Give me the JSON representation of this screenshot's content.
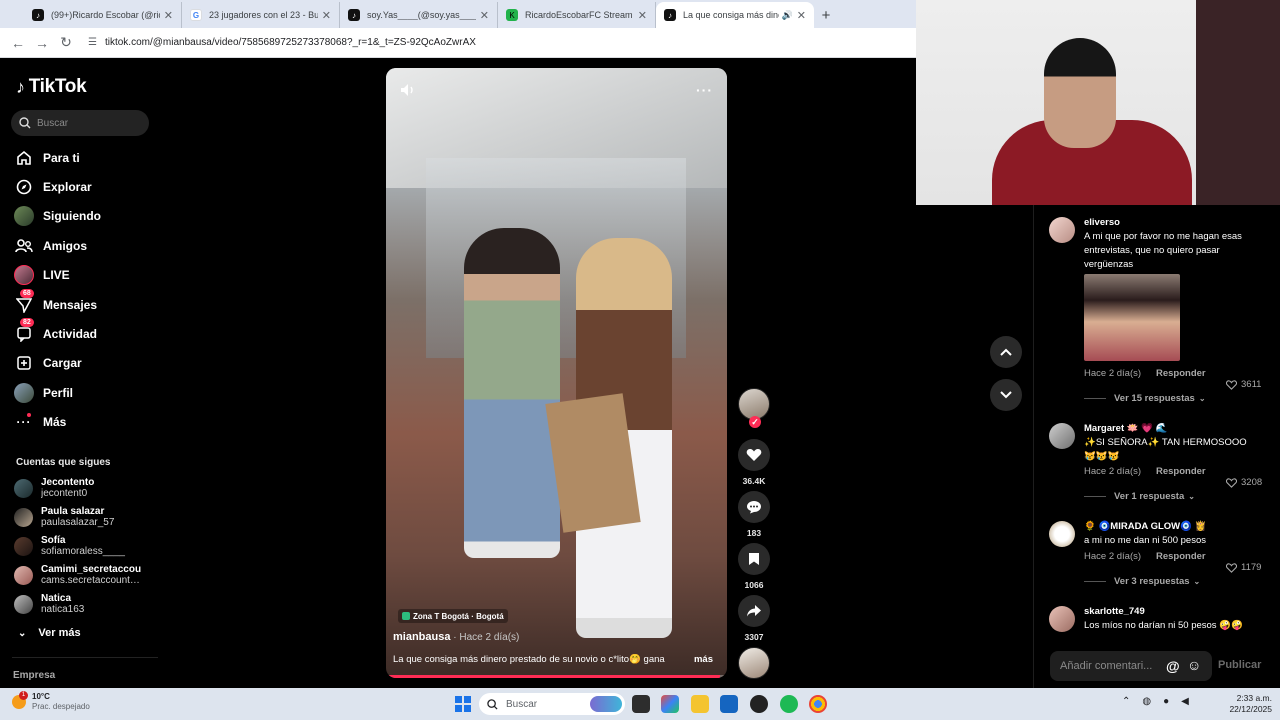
{
  "browser": {
    "tabs": [
      {
        "title": "(99+)Ricardo Escobar (@ric…",
        "icon": "tiktok-icon"
      },
      {
        "title": "23 jugadores con el 23 - Buscar",
        "icon": "google-icon"
      },
      {
        "title": "soy.Yas____(@soy.yas____) |",
        "icon": "tiktok-icon"
      },
      {
        "title": "RicardoEscobarFC Stream - Wa",
        "icon": "kick-icon"
      },
      {
        "title": "La que consiga más dinero",
        "icon": "tiktok-icon",
        "active": true
      }
    ],
    "url": "tiktok.com/@mianbausa/video/7585689725273378068?_r=1&_t=ZS-92QcAoZwrAX"
  },
  "sidebar": {
    "logo": "TikTok",
    "search_placeholder": "Buscar",
    "nav": [
      {
        "label": "Para ti",
        "icon": "home-icon"
      },
      {
        "label": "Explorar",
        "icon": "compass-icon"
      },
      {
        "label": "Siguiendo",
        "icon": "following-avatar-icon"
      },
      {
        "label": "Amigos",
        "icon": "friends-icon"
      },
      {
        "label": "LIVE",
        "icon": "live-avatar-icon"
      },
      {
        "label": "Mensajes",
        "icon": "messages-icon",
        "badge": "68"
      },
      {
        "label": "Actividad",
        "icon": "activity-icon",
        "badge": "82"
      },
      {
        "label": "Cargar",
        "icon": "upload-icon"
      },
      {
        "label": "Perfil",
        "icon": "profile-avatar-icon"
      },
      {
        "label": "Más",
        "icon": "more-dots-icon"
      }
    ],
    "following_header": "Cuentas que sigues",
    "following": [
      {
        "name": "Jecontento",
        "handle": "jecontent0"
      },
      {
        "name": "Paula salazar",
        "handle": "paulasalazar_57"
      },
      {
        "name": "Sofía",
        "handle": "sofiamoraless____"
      },
      {
        "name": "Camimi_secretaccou…",
        "handle": "cams.secretaccount…"
      },
      {
        "name": "Natica",
        "handle": "natica163"
      }
    ],
    "see_more": "Ver más",
    "company": "Empresa"
  },
  "video": {
    "location": "Zona T Bogotá · Bogotá",
    "author": "mianbausa",
    "time": " · Hace 2 día(s)",
    "caption": "La que consiga más dinero prestado de su novio o c*lito🤭 gana",
    "more": "más",
    "progress": 0.98
  },
  "actions": {
    "likes": "36.4K",
    "comments": "183",
    "saves": "1066",
    "shares": "3307"
  },
  "comments": [
    {
      "user": "eliverso",
      "text": "A mi que por favor no me hagan esas entrevistas, que no quiero pasar vergüenzas",
      "time": "Hace 2 día(s)",
      "reply": "Responder",
      "likes": "3611",
      "replies": "Ver 15 respuestas"
    },
    {
      "user": "Margaret 🪷 💗 🌊",
      "text": "✨SI SEÑORA✨ TAN HERMOSOOO 😿😿😿",
      "time": "Hace 2 día(s)",
      "reply": "Responder",
      "likes": "3208",
      "replies": "Ver 1 respuesta"
    },
    {
      "user": "🌻 🧿MIRADA GLOW🧿 👸",
      "text": "a mi no me dan ni 500 pesos",
      "time": "Hace 2 día(s)",
      "reply": "Responder",
      "likes": "1179",
      "replies": "Ver 3 respuestas"
    },
    {
      "user": "skarlotte_749",
      "text": "Los míos no darían ni 50 pesos 🤪🤪"
    }
  ],
  "comment_input": {
    "placeholder": "Añadir comentari...",
    "publish": "Publicar"
  },
  "taskbar": {
    "weather_temp": "10°C",
    "weather_desc": "Prac. despejado",
    "weather_alert": "1",
    "search": "Buscar",
    "time": "2:33 a.m.",
    "date": "22/12/2025"
  },
  "colors": {
    "tiktok_accent": "#fe2c55",
    "background": "#000000"
  }
}
